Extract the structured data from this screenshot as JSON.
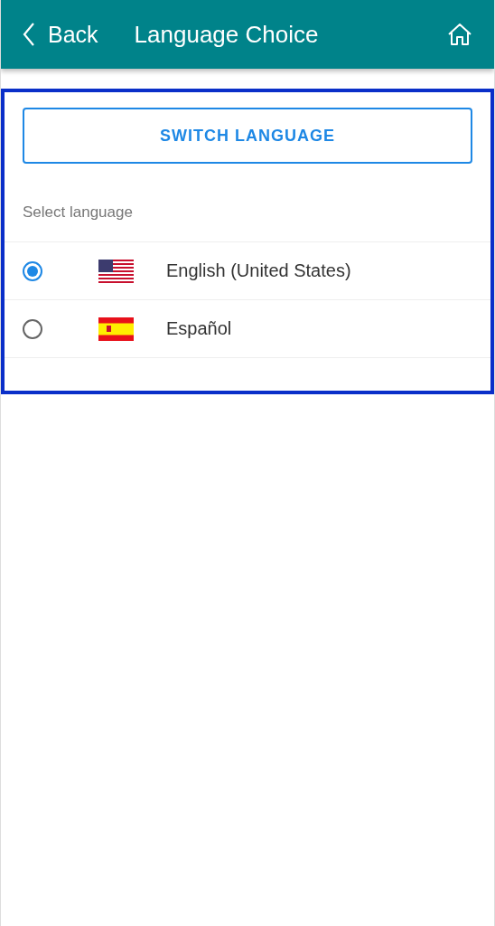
{
  "header": {
    "back": "Back",
    "title": "Language Choice"
  },
  "switch_button": "SWITCH LANGUAGE",
  "section_label": "Select language",
  "languages": [
    {
      "label": "English (United States)",
      "kind": "us",
      "selected": true
    },
    {
      "label": "Español",
      "kind": "es",
      "selected": false
    }
  ]
}
